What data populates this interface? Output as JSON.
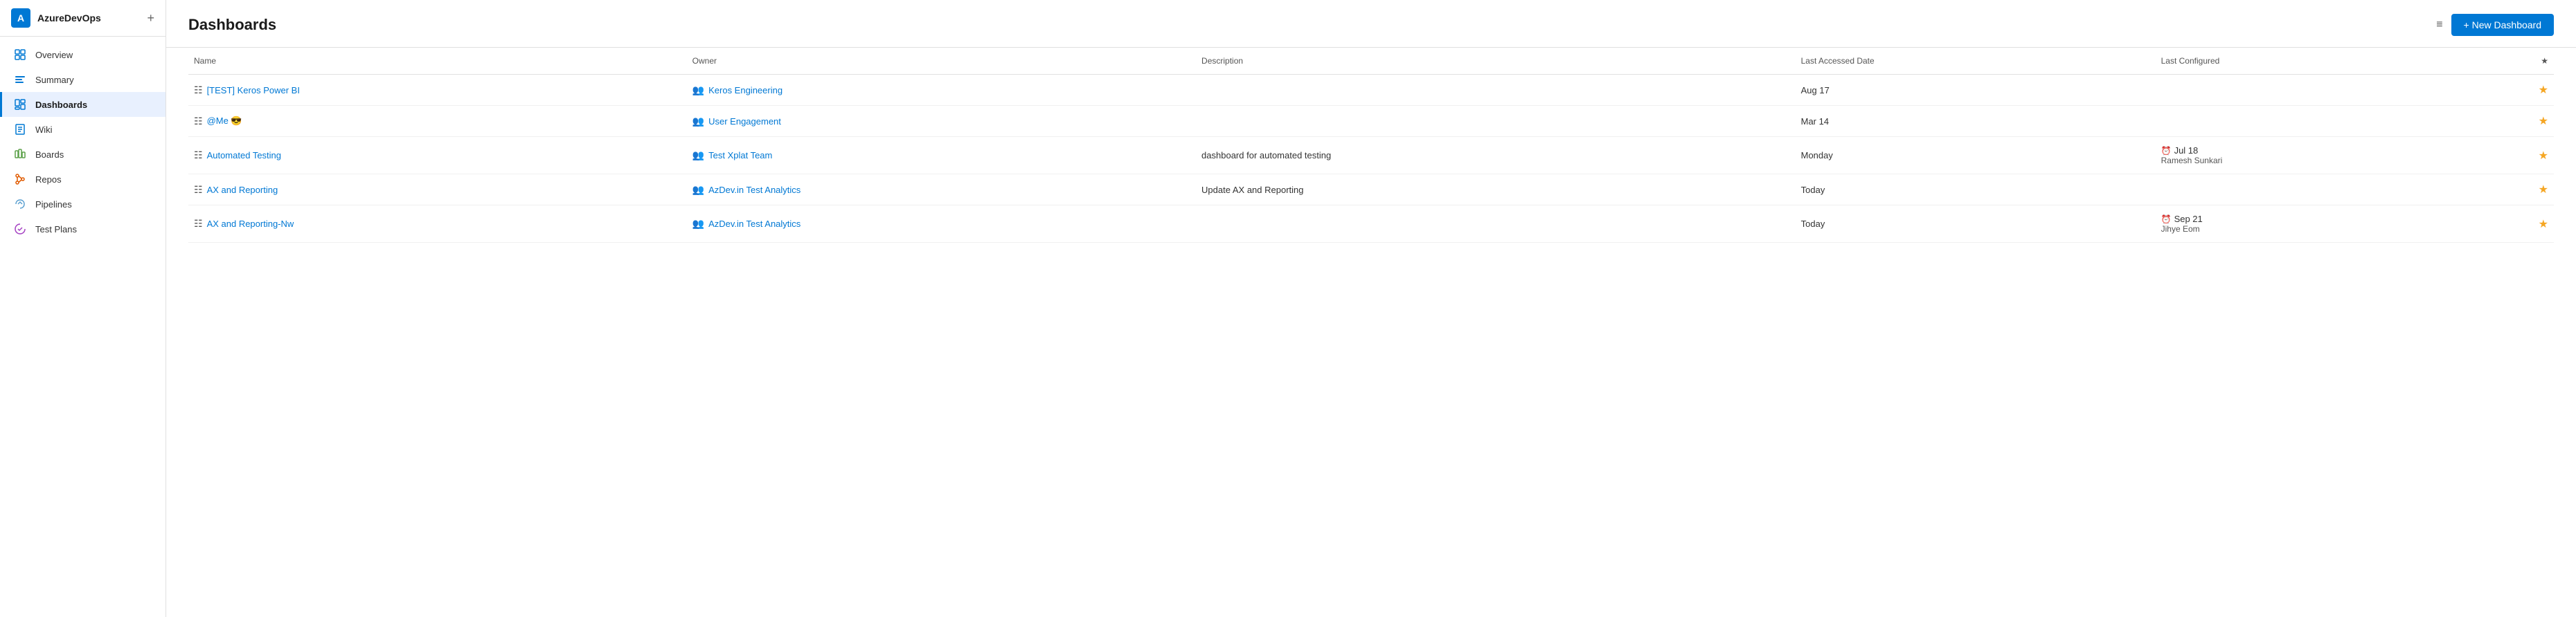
{
  "sidebar": {
    "logo_text": "A",
    "title": "AzureDevOps",
    "add_label": "+",
    "nav_items": [
      {
        "id": "overview",
        "label": "Overview",
        "icon": "overview",
        "active": false
      },
      {
        "id": "summary",
        "label": "Summary",
        "icon": "summary",
        "active": false
      },
      {
        "id": "dashboards",
        "label": "Dashboards",
        "icon": "dashboards",
        "active": true
      },
      {
        "id": "wiki",
        "label": "Wiki",
        "icon": "wiki",
        "active": false
      },
      {
        "id": "boards",
        "label": "Boards",
        "icon": "boards",
        "active": false
      },
      {
        "id": "repos",
        "label": "Repos",
        "icon": "repos",
        "active": false
      },
      {
        "id": "pipelines",
        "label": "Pipelines",
        "icon": "pipelines",
        "active": false
      },
      {
        "id": "testplans",
        "label": "Test Plans",
        "icon": "testplans",
        "active": false
      }
    ]
  },
  "main": {
    "page_title": "Dashboards",
    "new_dashboard_label": "+ New Dashboard",
    "table": {
      "columns": [
        {
          "id": "name",
          "label": "Name"
        },
        {
          "id": "owner",
          "label": "Owner"
        },
        {
          "id": "description",
          "label": "Description"
        },
        {
          "id": "last_accessed",
          "label": "Last Accessed Date"
        },
        {
          "id": "last_configured",
          "label": "Last Configured"
        },
        {
          "id": "star",
          "label": "☆"
        }
      ],
      "rows": [
        {
          "name": "[TEST] Keros Power BI",
          "owner": "Keros Engineering",
          "description": "",
          "last_accessed": "Aug 17",
          "last_configured": "",
          "last_configured_sub": "",
          "starred": true
        },
        {
          "name": "@Me 😎",
          "owner": "User Engagement",
          "description": "",
          "last_accessed": "Mar 14",
          "last_configured": "",
          "last_configured_sub": "",
          "starred": true
        },
        {
          "name": "Automated Testing",
          "owner": "Test Xplat Team",
          "description": "dashboard for automated testing",
          "last_accessed": "Monday",
          "last_configured": "Jul 18",
          "last_configured_sub": "Ramesh Sunkari",
          "starred": true
        },
        {
          "name": "AX and Reporting",
          "owner": "AzDev.in Test Analytics",
          "description": "Update AX and Reporting",
          "last_accessed": "Today",
          "last_configured": "",
          "last_configured_sub": "",
          "starred": true
        },
        {
          "name": "AX and Reporting-Nw",
          "owner": "AzDev.in Test Analytics",
          "description": "",
          "last_accessed": "Today",
          "last_configured": "Sep 21",
          "last_configured_sub": "Jihye Eom",
          "starred": true
        }
      ]
    }
  }
}
